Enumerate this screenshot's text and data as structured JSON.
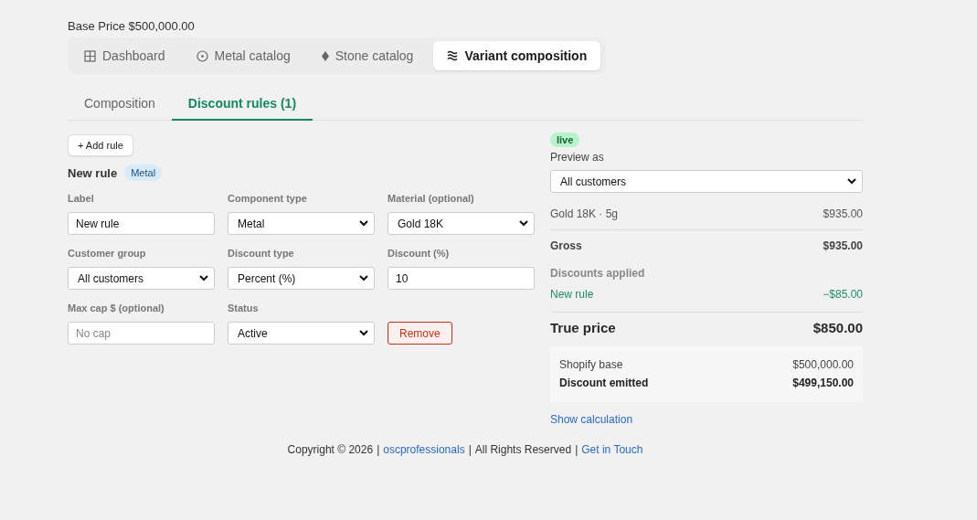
{
  "base_price": "Base Price $500,000.00",
  "nav_tabs": [
    {
      "label": "Dashboard",
      "selected": false
    },
    {
      "label": "Metal catalog",
      "selected": false
    },
    {
      "label": "Stone catalog",
      "selected": false
    },
    {
      "label": "Variant composition",
      "selected": true
    }
  ],
  "sub_tabs": [
    {
      "label": "Composition",
      "selected": false
    },
    {
      "label": "Discount rules (1)",
      "selected": true
    }
  ],
  "add_rule_button": "+ Add rule",
  "rule": {
    "title": "New rule",
    "tag": "Metal"
  },
  "fields": [
    {
      "kind": "text",
      "label": "Label",
      "value": "New rule"
    },
    {
      "kind": "select",
      "label": "Component type",
      "value": "Metal"
    },
    {
      "kind": "select",
      "label": "Material (optional)",
      "value": "Gold 18K"
    },
    {
      "kind": "select",
      "label": "Customer group",
      "value": "All customers"
    },
    {
      "kind": "select",
      "label": "Discount type",
      "value": "Percent (%)"
    },
    {
      "kind": "text",
      "label": "Discount (%)",
      "value": "10"
    },
    {
      "kind": "text",
      "label": "Max cap $ (optional)",
      "placeholder": "No cap"
    },
    {
      "kind": "select",
      "label": "Status",
      "value": "Active"
    },
    {
      "kind": "button",
      "value": "Remove"
    }
  ],
  "preview": {
    "badge": "live",
    "label": "Preview as",
    "value": "All customers",
    "line": {
      "label": "Gold 18K · 5g",
      "amount": "$935.00"
    },
    "gross": {
      "label": "Gross",
      "amount": "$935.00"
    },
    "discounts_heading": "Discounts applied",
    "discounts": [
      {
        "label": "New rule",
        "amount": "−$85.00"
      }
    ],
    "total": {
      "label": "True price",
      "amount": "$850.00"
    },
    "summary": [
      {
        "label": "Shopify base",
        "amount": "$500,000.00",
        "bold": false
      },
      {
        "label": "Discount emitted",
        "amount": "$499,150.00",
        "bold": true
      }
    ],
    "link": "Show calculation"
  },
  "footer": [
    {
      "kind": "text",
      "text": "Copyright © 2026"
    },
    {
      "kind": "sep",
      "text": "|"
    },
    {
      "kind": "link",
      "text": "oscprofessionals"
    },
    {
      "kind": "sep",
      "text": "|"
    },
    {
      "kind": "text",
      "text": "All Rights Reserved"
    },
    {
      "kind": "sep",
      "text": "|"
    },
    {
      "kind": "link",
      "text": "Get in Touch"
    }
  ]
}
